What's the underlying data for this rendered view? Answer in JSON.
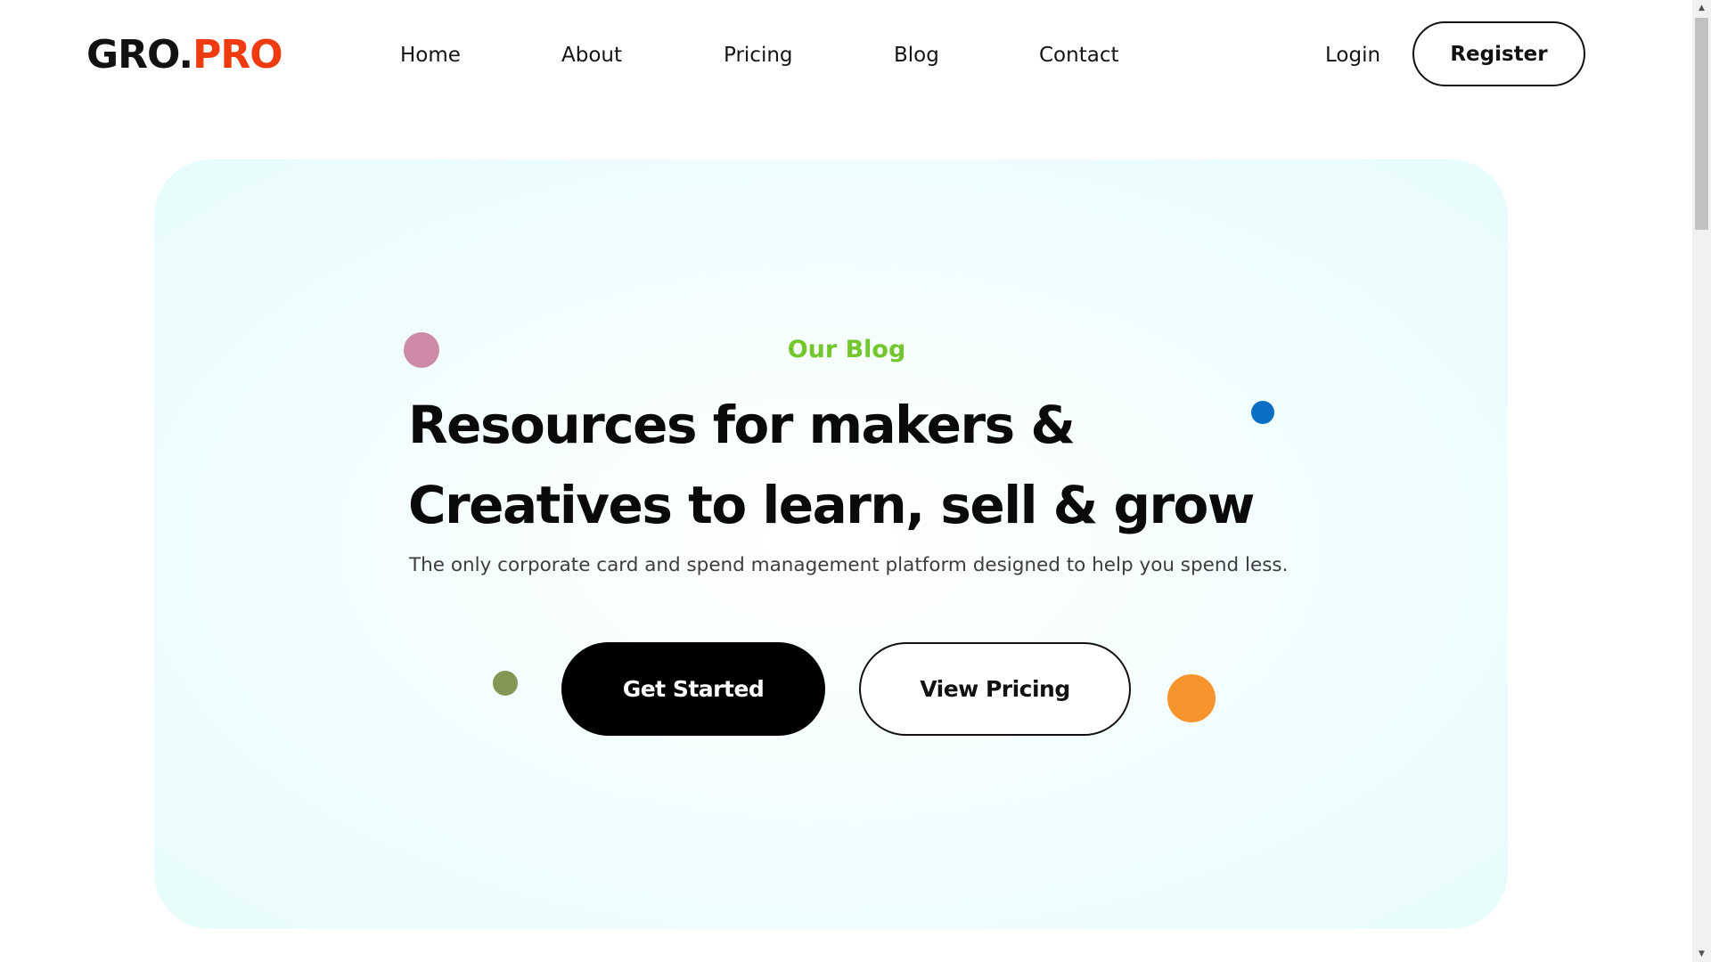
{
  "brand": {
    "part1": "GRO.",
    "part2": "PRO"
  },
  "nav": {
    "items": [
      {
        "label": "Home"
      },
      {
        "label": "About"
      },
      {
        "label": "Pricing"
      },
      {
        "label": "Blog"
      },
      {
        "label": "Contact"
      }
    ],
    "login_label": "Login",
    "register_label": "Register"
  },
  "hero": {
    "eyebrow": "Our Blog",
    "headline_line1": "Resources for makers &",
    "headline_line2": "Creatives to learn, sell & grow",
    "subtitle": "The only corporate card and spend management platform designed to help you spend less.",
    "primary_cta": "Get Started",
    "secondary_cta": "View Pricing"
  },
  "colors": {
    "brand_dark": "#111111",
    "brand_accent": "#ef3b10",
    "eyebrow_green": "#72c72c",
    "hero_bg": "#e7fcfc",
    "dot_pink": "#cc8aa8",
    "dot_blue": "#0b6fc4",
    "dot_olive": "#849653",
    "dot_orange": "#f7942d"
  },
  "icons": {
    "scroll_up": "triangle-up-icon",
    "scroll_down": "triangle-down-icon"
  }
}
